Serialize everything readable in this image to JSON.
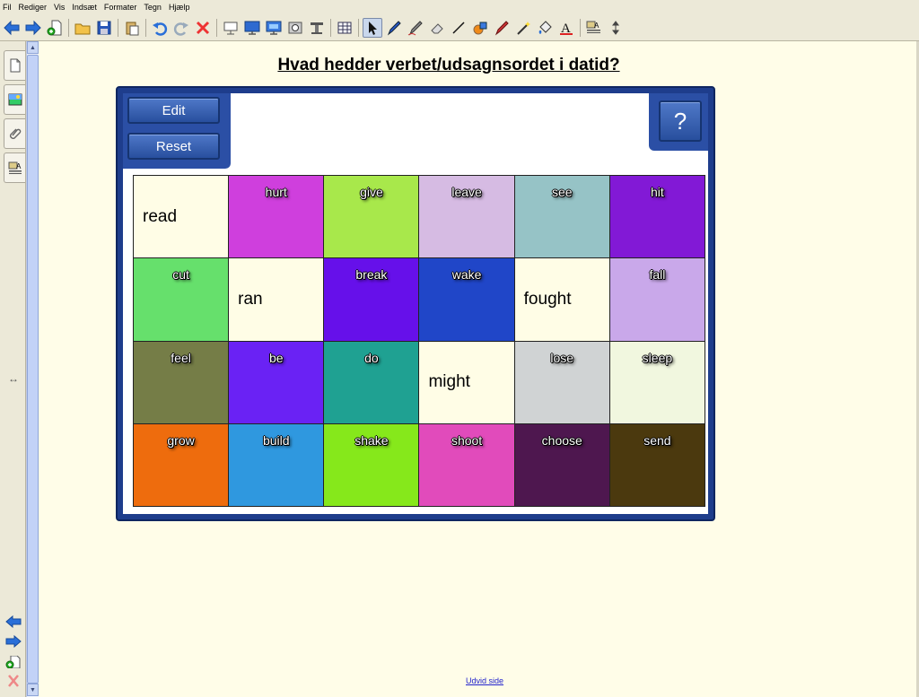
{
  "menu": [
    "Fil",
    "Rediger",
    "Vis",
    "Indsæt",
    "Formater",
    "Tegn",
    "Hjælp"
  ],
  "toolbar": {
    "groups": [
      [
        "back-arrow-icon",
        "forward-arrow-icon",
        "add-page-icon"
      ],
      [
        "open-folder-icon",
        "save-icon"
      ],
      [
        "paste-icon"
      ],
      [
        "undo-icon",
        "redo-icon",
        "delete-icon"
      ],
      [
        "screen-shade-icon",
        "full-screen-icon",
        "dual-display-icon",
        "capture-icon",
        "magic-pen-icon"
      ],
      [
        "table-icon"
      ],
      [
        "select-arrow-icon",
        "pen-icon",
        "creative-pen-icon",
        "eraser-icon",
        "line-icon",
        "shapes-icon",
        "highlighter-icon",
        "magic-wand-icon",
        "fill-icon",
        "text-icon"
      ],
      [
        "properties-icon",
        "more-icon"
      ]
    ],
    "active": "select-arrow-icon"
  },
  "sidebar": {
    "tabs": [
      "page-sorter-icon",
      "gallery-icon",
      "attachments-icon",
      "properties-icon"
    ],
    "resize_glyph": "↔"
  },
  "page": {
    "title": "Hvad hedder verbet/udsagnsordet i datid?",
    "footer_link": "Udvid side"
  },
  "widget": {
    "edit_label": "Edit",
    "reset_label": "Reset",
    "help_label": "?",
    "cards": [
      {
        "word": "read",
        "color": "#fffde6",
        "answer": true
      },
      {
        "word": "hurt",
        "color": "#cf3fdd",
        "answer": false
      },
      {
        "word": "give",
        "color": "#a8e84b",
        "answer": false
      },
      {
        "word": "leave",
        "color": "#d6bbe3",
        "answer": false
      },
      {
        "word": "see",
        "color": "#96c3c6",
        "answer": false
      },
      {
        "word": "hit",
        "color": "#8219d6",
        "answer": false
      },
      {
        "word": "cut",
        "color": "#66e06c",
        "answer": false
      },
      {
        "word": "ran",
        "color": "#fffde6",
        "answer": true
      },
      {
        "word": "break",
        "color": "#6610ea",
        "answer": false
      },
      {
        "word": "wake",
        "color": "#2046c8",
        "answer": false
      },
      {
        "word": "fought",
        "color": "#fffde6",
        "answer": true
      },
      {
        "word": "fall",
        "color": "#c9a8ea",
        "answer": false
      },
      {
        "word": "feel",
        "color": "#757d47",
        "answer": false
      },
      {
        "word": "be",
        "color": "#6a22f4",
        "answer": false
      },
      {
        "word": "do",
        "color": "#1fa192",
        "answer": false
      },
      {
        "word": "might",
        "color": "#fffde6",
        "answer": true
      },
      {
        "word": "lose",
        "color": "#d0d3d4",
        "answer": false
      },
      {
        "word": "sleep",
        "color": "#f1f7df",
        "answer": false
      },
      {
        "word": "grow",
        "color": "#ee6c0d",
        "answer": false
      },
      {
        "word": "build",
        "color": "#2f98df",
        "answer": false
      },
      {
        "word": "shake",
        "color": "#86e81b",
        "answer": false
      },
      {
        "word": "shoot",
        "color": "#e14bbb",
        "answer": false
      },
      {
        "word": "choose",
        "color": "#4e174f",
        "answer": false
      },
      {
        "word": "send",
        "color": "#4b390e",
        "answer": false
      }
    ]
  }
}
